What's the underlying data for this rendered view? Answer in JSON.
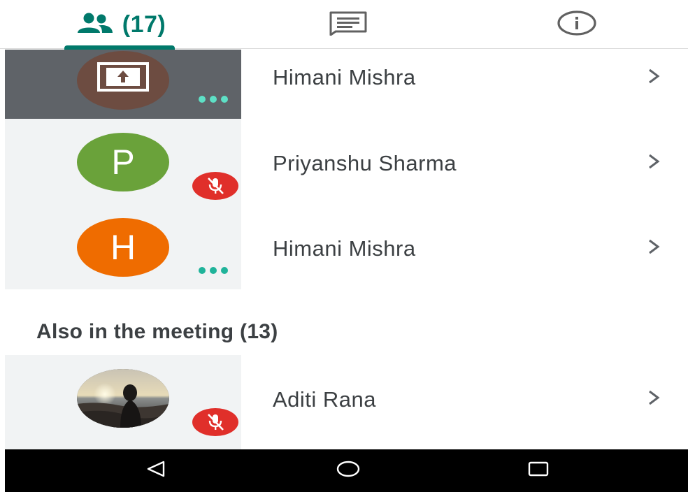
{
  "tabs": {
    "people": {
      "icon": "people-icon",
      "count": "(17)"
    },
    "chat": {
      "icon": "chat-icon"
    },
    "info": {
      "icon": "info-icon"
    }
  },
  "participants": [
    {
      "name": "Himani Mishra",
      "avatar": "screen-share-icon",
      "status": "speaking-dots"
    },
    {
      "name": "Priyanshu Sharma",
      "initial": "P",
      "avatar_color": "#6aa23a",
      "status": "muted"
    },
    {
      "name": "Himani Mishra",
      "initial": "H",
      "avatar_color": "#ef6c00",
      "status": "speaking-dots"
    }
  ],
  "also_in_meeting": {
    "heading": "Also in the meeting (13)",
    "items": [
      {
        "name": "Aditi Rana",
        "avatar": "photo",
        "status": "muted"
      }
    ]
  },
  "colors": {
    "accent": "#00796b",
    "muted_badge": "#e02f2a",
    "tile_bg": "#f1f3f4",
    "active_tile_bg": "#5f6368",
    "speaking_dots": "#5ee0c6"
  },
  "navbar": {
    "back": "back-icon",
    "home": "home-icon",
    "recents": "recents-icon"
  }
}
